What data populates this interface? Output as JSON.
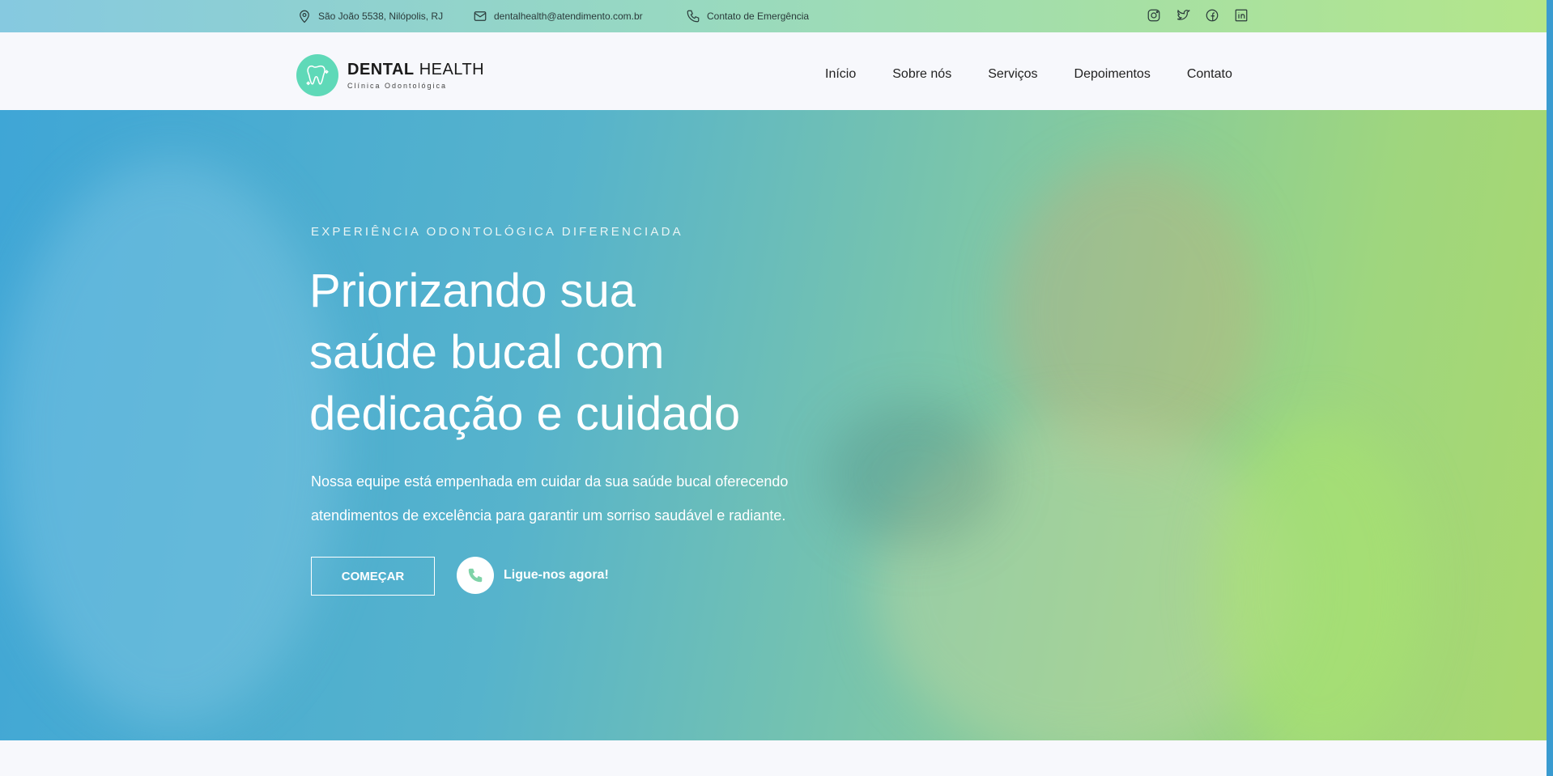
{
  "topbar": {
    "address": "São João 5538, Nilópolis, RJ",
    "email": "dentalhealth@atendimento.com.br",
    "emergency": "Contato de Emergência",
    "social": [
      "instagram-icon",
      "twitter-icon",
      "facebook-icon",
      "linkedin-icon"
    ]
  },
  "logo": {
    "name_bold": "DENTAL",
    "name_light": "HEALTH",
    "subtitle": "Clínica Odontológica"
  },
  "nav": {
    "items": [
      "Início",
      "Sobre nós",
      "Serviços",
      "Depoimentos",
      "Contato"
    ]
  },
  "hero": {
    "eyebrow": "EXPERIÊNCIA ODONTOLÓGICA DIFERENCIADA",
    "title_lines": [
      "Priorizando sua",
      "saúde bucal com",
      "dedicação e cuidado"
    ],
    "paragraph_lines": [
      "Nossa equipe está empenhada em cuidar da sua saúde bucal oferecendo",
      "atendimentos de excelência para garantir um sorriso saudável e radiante."
    ],
    "cta_label": "COMEÇAR",
    "call_label": "Ligue-nos agora!"
  },
  "colors": {
    "accent": "#5fd9b8",
    "gradient_start": "#3fa6d6",
    "gradient_end": "#a9d86e"
  }
}
